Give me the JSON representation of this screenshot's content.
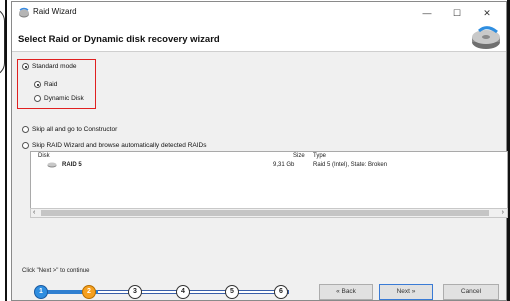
{
  "window": {
    "title": "Raid Wizard",
    "controls": {
      "minimize": "—",
      "maximize": "☐",
      "close": "✕"
    }
  },
  "header": {
    "title": "Select Raid or Dynamic disk recovery wizard"
  },
  "modes": {
    "standard": {
      "label": "Standard mode",
      "selected": true
    },
    "raid": {
      "label": "Raid",
      "selected": true
    },
    "dynamic_disk": {
      "label": "Dynamic Disk",
      "selected": false
    },
    "skip_constructor": {
      "label": "Skip all and go to Constructor",
      "selected": false
    },
    "skip_wizard": {
      "label": "Skip RAID Wizard and browse automatically detected RAIDs",
      "selected": false
    }
  },
  "table": {
    "columns": {
      "disk": "Disk",
      "size": "Size",
      "type": "Type"
    },
    "rows": [
      {
        "disk": "RAID 5",
        "size": "9,31 Gb",
        "type": "Raid 5 (Intel), State: Broken"
      }
    ]
  },
  "hint": "Click \"Next >\" to continue",
  "steps": [
    {
      "label": "1",
      "state": "done"
    },
    {
      "label": "2",
      "state": "current"
    },
    {
      "label": "3",
      "state": "pending"
    },
    {
      "label": "4",
      "state": "pending"
    },
    {
      "label": "5",
      "state": "pending"
    },
    {
      "label": "6",
      "state": "pending"
    }
  ],
  "buttons": {
    "back": "« Back",
    "next": "Next »",
    "cancel": "Cancel"
  },
  "colors": {
    "highlight": "#e02020",
    "step_done": "#2f8ee0",
    "step_current": "#f5a020"
  }
}
